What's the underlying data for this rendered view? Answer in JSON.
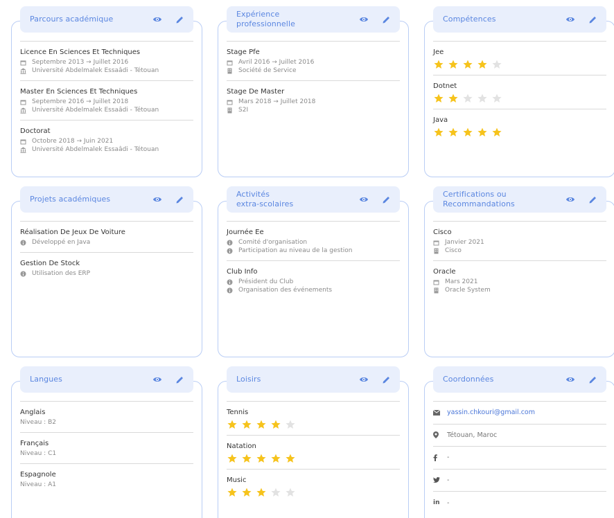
{
  "colors": {
    "accent": "#5a86e0",
    "star_on": "#f6c31c",
    "star_off": "#e2e2e2",
    "border": "#b9cdf5",
    "header_bg": "#e9effc"
  },
  "cards": {
    "parcours": {
      "title": "Parcours académique",
      "items": [
        {
          "title": "Licence En Sciences Et Techniques",
          "dates": "Septembre 2013 → Juillet 2016",
          "place": "Université Abdelmalek Essaâdi - Tétouan"
        },
        {
          "title": "Master En Sciences Et Techniques",
          "dates": "Septembre 2016 → Juillet 2018",
          "place": "Université Abdelmalek Essaâdi - Tétouan"
        },
        {
          "title": "Doctorat",
          "dates": "Octobre 2018 → Juin 2021",
          "place": "Université Abdelmalek Essaâdi - Tétouan"
        }
      ]
    },
    "experience": {
      "title": "Expérience\nprofessionnelle",
      "items": [
        {
          "title": "Stage Pfe",
          "dates": "Avril 2016 → Juillet 2016",
          "company": "Société de Service"
        },
        {
          "title": "Stage De Master",
          "dates": "Mars 2018 → Juillet 2018",
          "company": "S2I"
        }
      ]
    },
    "competences": {
      "title": "Compétences",
      "items": [
        {
          "name": "Jee",
          "rating": 4
        },
        {
          "name": "Dotnet",
          "rating": 2
        },
        {
          "name": "Java",
          "rating": 5
        }
      ]
    },
    "projets": {
      "title": "Projets académiques",
      "items": [
        {
          "title": "Réalisation De Jeux De Voiture",
          "details": [
            "Développé en Java"
          ]
        },
        {
          "title": "Gestion De Stock",
          "details": [
            "Utilisation des ERP"
          ]
        }
      ]
    },
    "activites": {
      "title": "Activités\nextra-scolaires",
      "items": [
        {
          "title": "Journée Ee",
          "details": [
            "Comité d'organisation",
            "Participation au niveau de la gestion"
          ]
        },
        {
          "title": "Club Info",
          "details": [
            "Président du Club",
            "Organisation des événements"
          ]
        }
      ]
    },
    "certifications": {
      "title": "Certifications ou\nRecommandations",
      "items": [
        {
          "title": "Cisco",
          "date": "Janvier 2021",
          "org": "Cisco"
        },
        {
          "title": "Oracle",
          "date": "Mars 2021",
          "org": "Oracle System"
        }
      ]
    },
    "langues": {
      "title": "Langues",
      "items": [
        {
          "name": "Anglais",
          "level": "Niveau : B2"
        },
        {
          "name": "Français",
          "level": "Niveau : C1"
        },
        {
          "name": "Espagnole",
          "level": "Niveau : A1"
        }
      ]
    },
    "loisirs": {
      "title": "Loisirs",
      "items": [
        {
          "name": "Tennis",
          "rating": 4
        },
        {
          "name": "Natation",
          "rating": 5
        },
        {
          "name": "Music",
          "rating": 3
        }
      ]
    },
    "coordonnees": {
      "title": "Coordonnées",
      "email": "yassin.chkouri@gmail.com",
      "location": "Tétouan, Maroc",
      "facebook": "-",
      "twitter": "-",
      "linkedin": "-"
    }
  }
}
